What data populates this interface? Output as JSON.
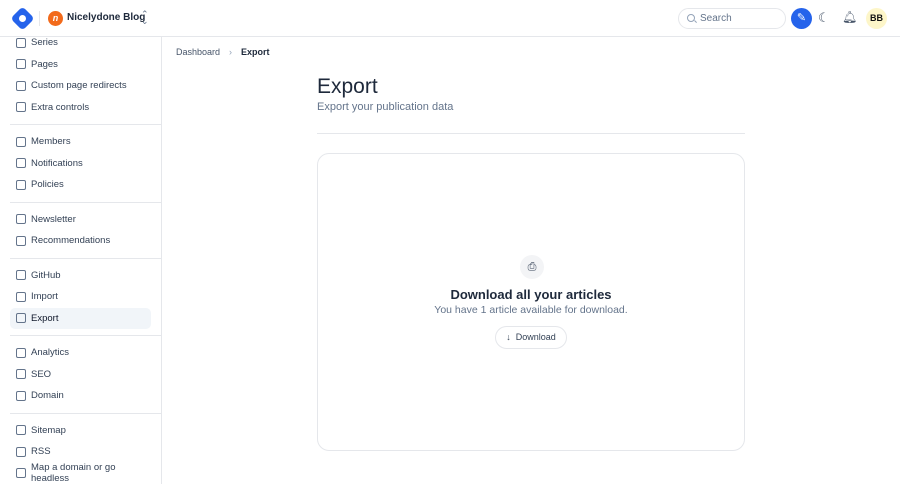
{
  "header": {
    "blog_name": "Nicelydone Blog",
    "blog_initial": "n",
    "search_placeholder": "Search",
    "avatar": "BB"
  },
  "sidebar": {
    "groups": [
      [
        {
          "label": "Series"
        },
        {
          "label": "Pages"
        },
        {
          "label": "Custom page redirects"
        },
        {
          "label": "Extra controls"
        }
      ],
      [
        {
          "label": "Members"
        },
        {
          "label": "Notifications"
        },
        {
          "label": "Policies"
        }
      ],
      [
        {
          "label": "Newsletter"
        },
        {
          "label": "Recommendations"
        }
      ],
      [
        {
          "label": "GitHub"
        },
        {
          "label": "Import"
        },
        {
          "label": "Export"
        }
      ],
      [
        {
          "label": "Analytics"
        },
        {
          "label": "SEO"
        },
        {
          "label": "Domain"
        }
      ],
      [
        {
          "label": "Sitemap"
        },
        {
          "label": "RSS"
        },
        {
          "label": "Map a domain or go headless"
        }
      ]
    ]
  },
  "breadcrumb": {
    "root": "Dashboard",
    "current": "Export"
  },
  "page": {
    "title": "Export",
    "subtitle": "Export your publication data"
  },
  "card": {
    "heading": "Download all your articles",
    "text": "You have 1 article available for download.",
    "button": "Download"
  }
}
